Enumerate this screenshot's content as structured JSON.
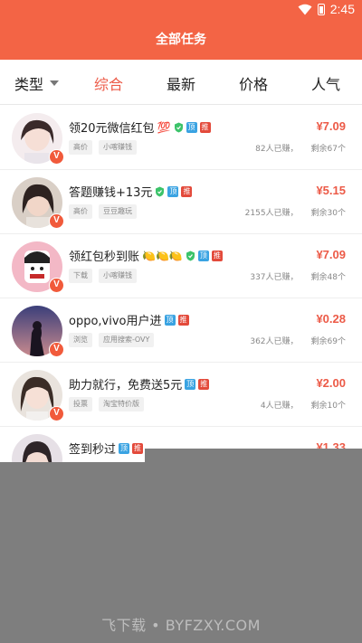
{
  "status_bar": {
    "time": "2:45"
  },
  "header": {
    "title": "全部任务"
  },
  "tabs": [
    {
      "label": "类型"
    },
    {
      "label": "综合"
    },
    {
      "label": "最新"
    },
    {
      "label": "价格"
    },
    {
      "label": "人气"
    }
  ],
  "tags": {
    "ding": "顶",
    "tui": "推"
  },
  "badge": "V",
  "tasks": [
    {
      "title": "领20元微信红包",
      "emoji": "💯",
      "price": "¥7.09",
      "chip1": "高价",
      "chip2": "小喀赚钱",
      "joined": "82人已赚，",
      "remaining": "剩余67个"
    },
    {
      "title": "答题赚钱+13元",
      "emoji": "",
      "price": "¥5.15",
      "chip1": "高价",
      "chip2": "豆豆趣玩",
      "joined": "2155人已赚，",
      "remaining": "剩余30个"
    },
    {
      "title": "领红包秒到账",
      "emoji": "🍋🍋🍋",
      "price": "¥7.09",
      "chip1": "下载",
      "chip2": "小喀赚钱",
      "joined": "337人已赚，",
      "remaining": "剩余48个"
    },
    {
      "title": "oppo,vivo用户进",
      "emoji": "",
      "price": "¥0.28",
      "chip1": "浏览",
      "chip2": "应用搜索-OVY",
      "joined": "362人已赚，",
      "remaining": "剩余69个"
    },
    {
      "title": "助力就行，免费送5元",
      "emoji": "",
      "price": "¥2.00",
      "chip1": "投票",
      "chip2": "淘宝特价版",
      "joined": "4人已赚，",
      "remaining": "剩余10个"
    },
    {
      "title": "签到秒过",
      "emoji": "",
      "price": "¥1.33",
      "chip1": "",
      "chip2": "",
      "joined": "",
      "remaining": ""
    }
  ],
  "watermark": "飞下载 • BYFZXY.COM"
}
